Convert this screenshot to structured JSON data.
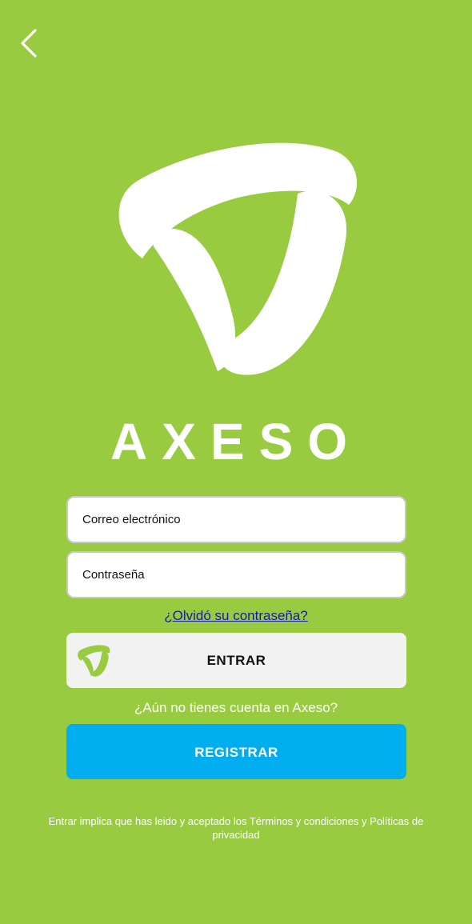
{
  "nav": {
    "back_icon": "chevron-left-icon"
  },
  "brand": {
    "name": "AXESO",
    "logo_icon": "axeso-logo-icon"
  },
  "form": {
    "email_placeholder": "Correo electrónico",
    "password_placeholder": "Contraseña",
    "forgot_password": "¿Olvidó su contraseña?",
    "login_label": "ENTRAR",
    "no_account_text": "¿Aún no tienes cuenta en Axeso?",
    "register_label": "REGISTRAR"
  },
  "footer": {
    "legal_text": "Entrar implica que has leido y aceptado los Términos y condiciones y Políticas de privacidad"
  },
  "colors": {
    "background": "#99CB40",
    "register_button": "#00AEEF",
    "login_button": "#F2F2F2",
    "link": "#1a1aa6"
  }
}
